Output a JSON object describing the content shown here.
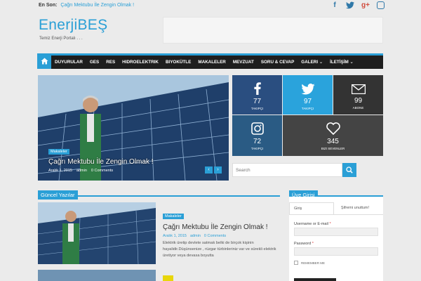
{
  "topbar": {
    "label": "En Son:",
    "headline": "Çağrı Mektubu İle Zengin Olmak !",
    "social_icons": [
      "facebook-icon",
      "twitter-icon",
      "google-plus-icon",
      "instagram-icon"
    ]
  },
  "header": {
    "logo": "EnerjiBEŞ",
    "tagline": "Temiz Enerji Portalı . . ."
  },
  "nav": {
    "items": [
      "DUYURULAR",
      "GES",
      "RES",
      "HIDROELEKTRIK",
      "BIYOKÜTLE",
      "MAKALELER",
      "MEVZUAT",
      "SORU & CEVAP",
      "GALERI",
      "İLETİŞİM"
    ],
    "dropdown_items": [
      "GALERI",
      "İLETİŞİM"
    ]
  },
  "slider": {
    "category": "Makaleler",
    "title": "Çağrı Mektubu İle Zengin Olmak !",
    "date": "Aralık 1, 2015",
    "author": "admin",
    "comments": "0 Comments"
  },
  "social_tiles": [
    {
      "icon": "facebook-icon",
      "count": "77",
      "label": "TAKIPÇI",
      "color": "#2a4e80"
    },
    {
      "icon": "twitter-icon",
      "count": "97",
      "label": "TAKIPÇI",
      "color": "#2aa3dc"
    },
    {
      "icon": "mail-icon",
      "count": "99",
      "label": "ABONE",
      "color": "#333333"
    },
    {
      "icon": "instagram-icon",
      "count": "72",
      "label": "TAKIPÇI",
      "color": "#2a5b84"
    },
    {
      "icon": "heart-icon",
      "count": "345",
      "label": "BIZI SEVENLER",
      "color": "#444444"
    }
  ],
  "search": {
    "placeholder": "Search"
  },
  "recent": {
    "heading": "Güncel Yazılar",
    "post": {
      "category": "Makaleler",
      "title": "Çağrı Mektubu İle Zengin Olmak !",
      "date": "Aralık 1, 2015",
      "author": "admin",
      "comments": "0 Comments",
      "excerpt": "Elektrik üretip devlete satmak belki de birçok kişinin hayalidir.Düşünsenize , rüzgar türbinleriniz var ve sürekli elektrik üretiyor veya devasa boyutta"
    }
  },
  "login": {
    "heading": "Üye Girişi",
    "tab_login": "Giriş",
    "tab_forgot": "Şifremi unuttum!",
    "username_label": "Username or E-mail",
    "password_label": "Password",
    "required_mark": "*",
    "remember": "REMEMBER ME"
  },
  "colors": {
    "accent": "#2a9fd6",
    "nav_bg": "#1e1e1e"
  }
}
